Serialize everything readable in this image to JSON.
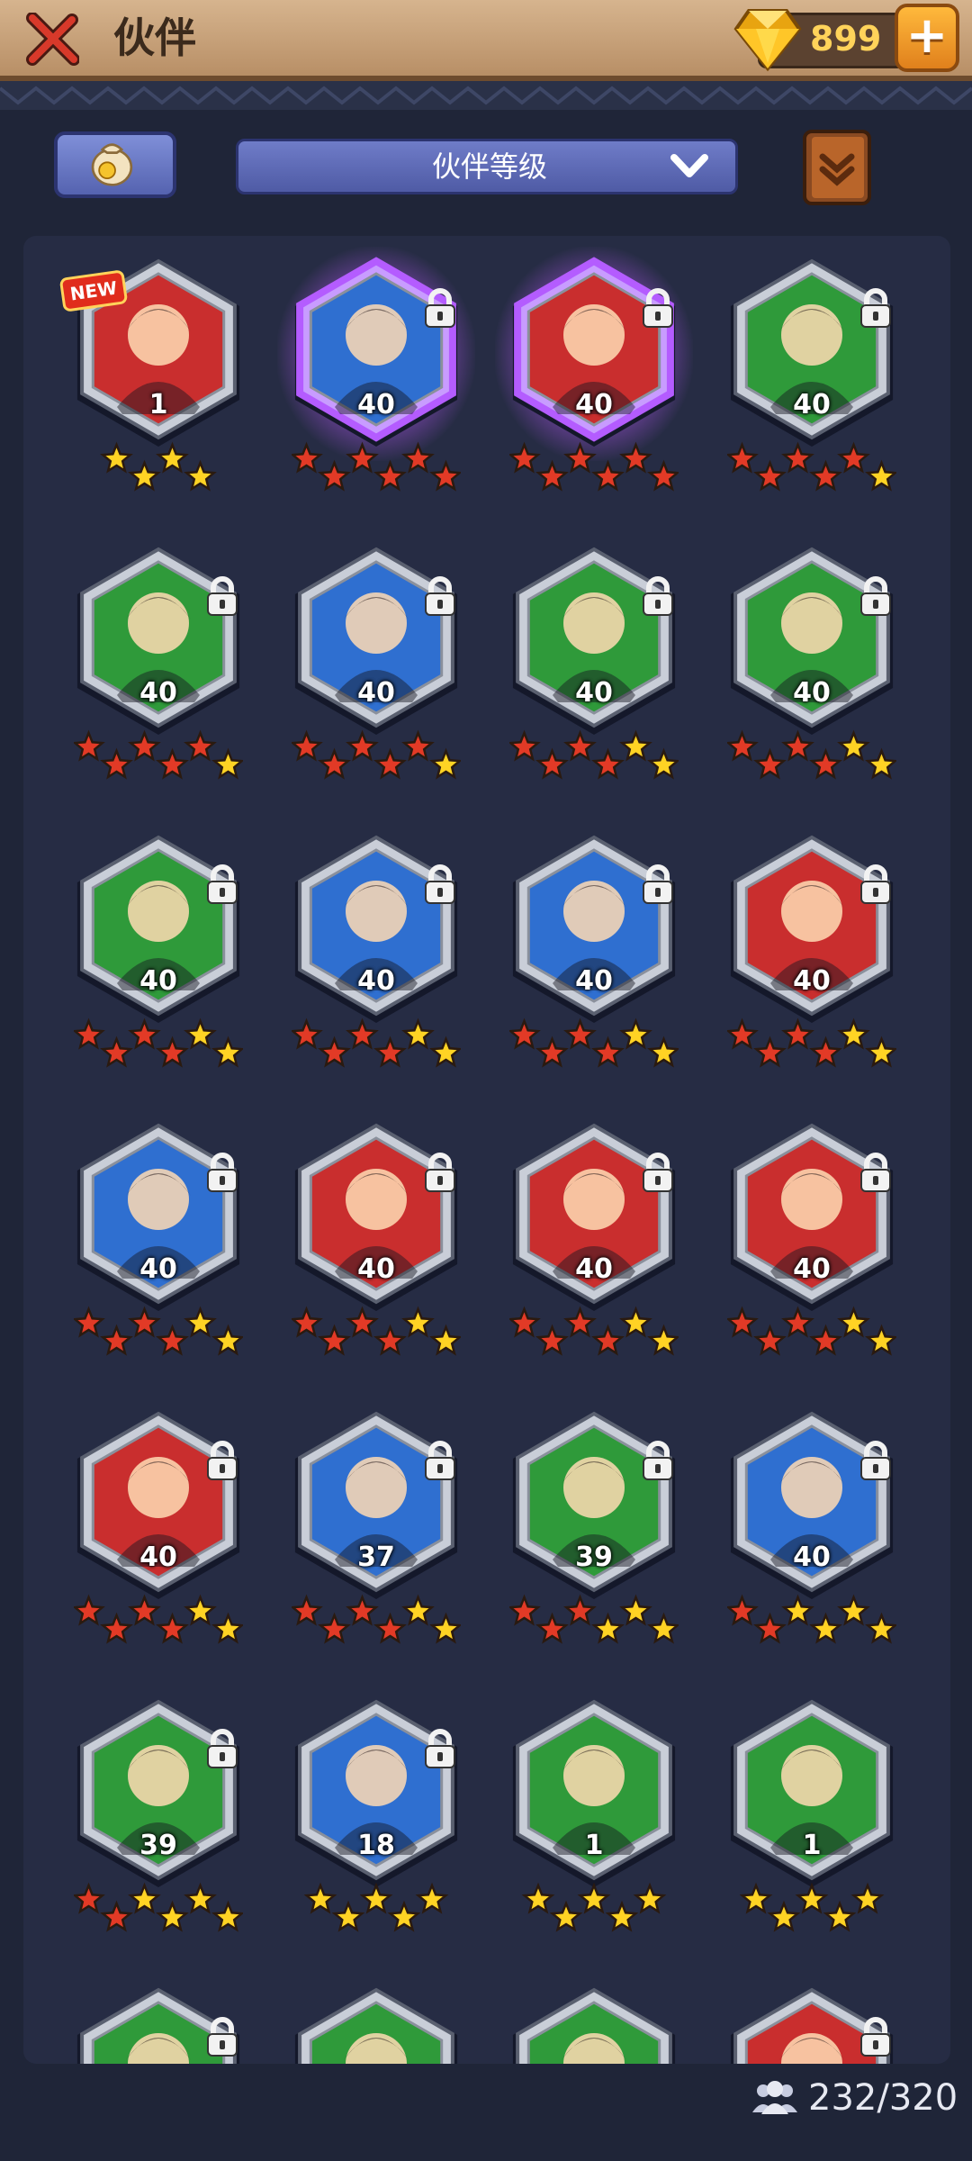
{
  "header": {
    "title": "伙伴",
    "gem_count": "899",
    "plus_label": "+",
    "icons": {
      "close": "close-x-icon",
      "gem": "gem-icon",
      "plus": "plus-icon"
    }
  },
  "toolbar": {
    "sort_label": "伙伴等级",
    "icons": {
      "bag": "coin-bag-icon",
      "sort": "chevron-down-icon",
      "book": "book-icon"
    }
  },
  "colors": {
    "hex_red": "#c92e2e",
    "hex_blue": "#2f6fd0",
    "hex_green": "#2f9a3a",
    "star_red": "#e23a26",
    "star_gold": "#ffd324",
    "glow_purple": "#b45cff"
  },
  "heroes": [
    {
      "level": "1",
      "bg": "red",
      "locked": false,
      "new": true,
      "new_label": "NEW",
      "glow": false,
      "stars": [
        "gold",
        "gold",
        "gold",
        "gold"
      ]
    },
    {
      "level": "40",
      "bg": "blue",
      "locked": true,
      "glow": true,
      "stars": [
        "red",
        "red",
        "red",
        "red",
        "red",
        "red"
      ]
    },
    {
      "level": "40",
      "bg": "red",
      "locked": true,
      "glow": true,
      "stars": [
        "red",
        "red",
        "red",
        "red",
        "red",
        "red"
      ]
    },
    {
      "level": "40",
      "bg": "green",
      "locked": true,
      "glow": false,
      "stars": [
        "red",
        "red",
        "red",
        "red",
        "red",
        "gold"
      ]
    },
    {
      "level": "40",
      "bg": "green",
      "locked": true,
      "glow": false,
      "stars": [
        "red",
        "red",
        "red",
        "red",
        "red",
        "gold"
      ]
    },
    {
      "level": "40",
      "bg": "blue",
      "locked": true,
      "glow": false,
      "stars": [
        "red",
        "red",
        "red",
        "red",
        "red",
        "gold"
      ]
    },
    {
      "level": "40",
      "bg": "green",
      "locked": true,
      "glow": false,
      "stars": [
        "red",
        "red",
        "red",
        "red",
        "gold",
        "gold"
      ]
    },
    {
      "level": "40",
      "bg": "green",
      "locked": true,
      "glow": false,
      "stars": [
        "red",
        "red",
        "red",
        "red",
        "gold",
        "gold"
      ]
    },
    {
      "level": "40",
      "bg": "green",
      "locked": true,
      "glow": false,
      "stars": [
        "red",
        "red",
        "red",
        "red",
        "gold",
        "gold"
      ]
    },
    {
      "level": "40",
      "bg": "blue",
      "locked": true,
      "glow": false,
      "stars": [
        "red",
        "red",
        "red",
        "red",
        "gold",
        "gold"
      ]
    },
    {
      "level": "40",
      "bg": "blue",
      "locked": true,
      "glow": false,
      "stars": [
        "red",
        "red",
        "red",
        "red",
        "gold",
        "gold"
      ]
    },
    {
      "level": "40",
      "bg": "red",
      "locked": true,
      "glow": false,
      "stars": [
        "red",
        "red",
        "red",
        "red",
        "gold",
        "gold"
      ]
    },
    {
      "level": "40",
      "bg": "blue",
      "locked": true,
      "glow": false,
      "stars": [
        "red",
        "red",
        "red",
        "red",
        "gold",
        "gold"
      ]
    },
    {
      "level": "40",
      "bg": "red",
      "locked": true,
      "glow": false,
      "stars": [
        "red",
        "red",
        "red",
        "red",
        "gold",
        "gold"
      ]
    },
    {
      "level": "40",
      "bg": "red",
      "locked": true,
      "glow": false,
      "stars": [
        "red",
        "red",
        "red",
        "red",
        "gold",
        "gold"
      ]
    },
    {
      "level": "40",
      "bg": "red",
      "locked": true,
      "glow": false,
      "stars": [
        "red",
        "red",
        "red",
        "red",
        "gold",
        "gold"
      ]
    },
    {
      "level": "40",
      "bg": "red",
      "locked": true,
      "glow": false,
      "stars": [
        "red",
        "red",
        "red",
        "red",
        "gold",
        "gold"
      ]
    },
    {
      "level": "37",
      "bg": "blue",
      "locked": true,
      "glow": false,
      "stars": [
        "red",
        "red",
        "red",
        "red",
        "gold",
        "gold"
      ]
    },
    {
      "level": "39",
      "bg": "green",
      "locked": true,
      "glow": false,
      "stars": [
        "red",
        "red",
        "red",
        "gold",
        "gold",
        "gold"
      ]
    },
    {
      "level": "40",
      "bg": "blue",
      "locked": true,
      "glow": false,
      "stars": [
        "red",
        "red",
        "gold",
        "gold",
        "gold",
        "gold"
      ]
    },
    {
      "level": "39",
      "bg": "green",
      "locked": true,
      "glow": false,
      "stars": [
        "red",
        "red",
        "gold",
        "gold",
        "gold",
        "gold"
      ]
    },
    {
      "level": "18",
      "bg": "blue",
      "locked": true,
      "glow": false,
      "stars": [
        "gold",
        "gold",
        "gold",
        "gold",
        "gold"
      ]
    },
    {
      "level": "1",
      "bg": "green",
      "locked": false,
      "glow": false,
      "stars": [
        "gold",
        "gold",
        "gold",
        "gold",
        "gold"
      ]
    },
    {
      "level": "1",
      "bg": "green",
      "locked": false,
      "glow": false,
      "stars": [
        "gold",
        "gold",
        "gold",
        "gold",
        "gold"
      ]
    },
    {
      "level": "",
      "bg": "green",
      "locked": true,
      "glow": false,
      "stars": []
    },
    {
      "level": "",
      "bg": "green",
      "locked": false,
      "glow": false,
      "stars": []
    },
    {
      "level": "",
      "bg": "green",
      "locked": false,
      "glow": false,
      "stars": []
    },
    {
      "level": "",
      "bg": "red",
      "locked": true,
      "glow": false,
      "stars": []
    }
  ],
  "footer": {
    "collection_count": "232/320",
    "icon": "group-icon"
  }
}
